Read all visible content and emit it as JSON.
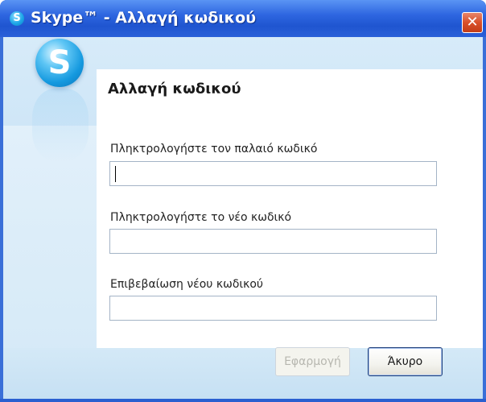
{
  "window": {
    "title": "Skype™ - Αλλαγή κωδικού",
    "icon": "skype-icon",
    "close_label": "✕"
  },
  "dialog": {
    "logo": "skype-logo",
    "logo_letter": "S",
    "heading": "Αλλαγή κωδικού",
    "fields": [
      {
        "label": "Πληκτρολογήστε τον παλαιό κωδικό",
        "value": ""
      },
      {
        "label": "Πληκτρολογήστε το νέο κωδικό",
        "value": ""
      },
      {
        "label": "Επιβεβαίωση νέου κωδικού",
        "value": ""
      }
    ]
  },
  "buttons": {
    "apply_label": "Εφαρμογή",
    "apply_enabled": false,
    "cancel_label": "Άκυρο"
  },
  "colors": {
    "title_bar": "#2e66e0",
    "close_button": "#d9502a",
    "panel_background": "#d7ebf9",
    "skype_blue": "#1599df"
  }
}
